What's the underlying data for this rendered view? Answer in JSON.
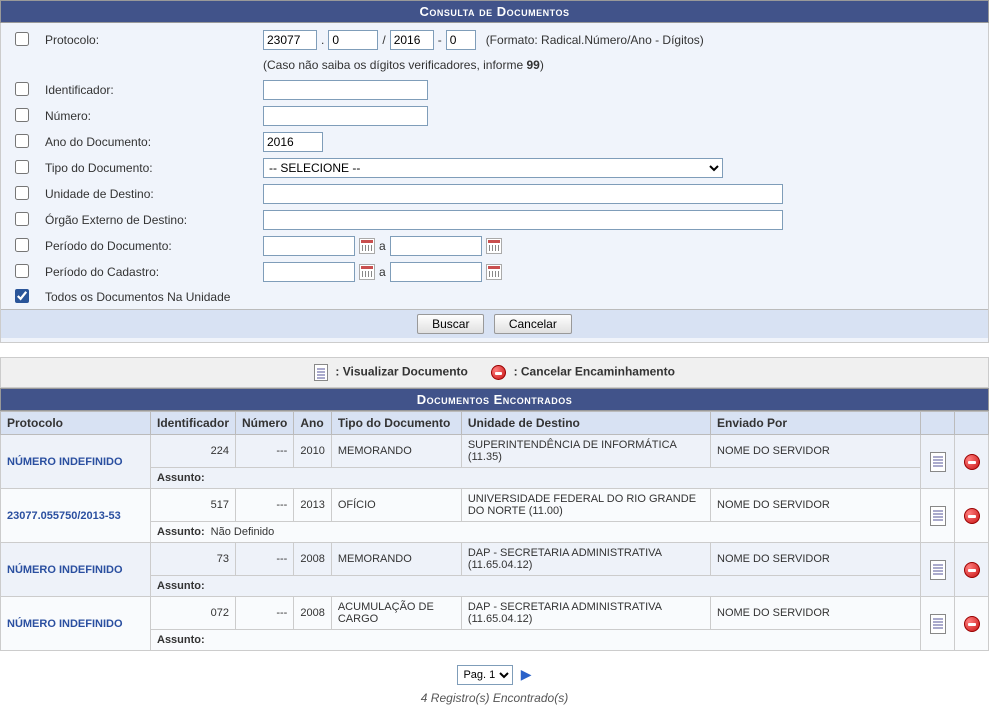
{
  "headers": {
    "form_title": "Consulta de Documentos",
    "results_title": "Documentos Encontrados"
  },
  "form": {
    "protocolo": {
      "label": "Protocolo:",
      "radical": "23077",
      "numero": "0",
      "ano": "2016",
      "digitos": "0",
      "format_hint": "(Formato: Radical.Número/Ano - Dígitos)",
      "hint2_a": "(Caso não saiba os dígitos verificadores, informe ",
      "hint2_b": "99",
      "hint2_c": ")"
    },
    "identificador_label": "Identificador:",
    "numero_label": "Número:",
    "ano_doc": {
      "label": "Ano do Documento:",
      "value": "2016"
    },
    "tipo_doc": {
      "label": "Tipo do Documento:",
      "selected": "-- SELECIONE --"
    },
    "unidade_destino_label": "Unidade de Destino:",
    "orgao_externo_label": "Órgão Externo de Destino:",
    "periodo_doc": {
      "label": "Período do Documento:",
      "sep": "a"
    },
    "periodo_cad": {
      "label": "Período do Cadastro:",
      "sep": "a"
    },
    "todos_label": "Todos os Documentos Na Unidade",
    "buttons": {
      "buscar": "Buscar",
      "cancelar": "Cancelar"
    }
  },
  "legend": {
    "view": ": Visualizar Documento",
    "cancel": ": Cancelar Encaminhamento"
  },
  "columns": {
    "protocolo": "Protocolo",
    "identificador": "Identificador",
    "numero": "Número",
    "ano": "Ano",
    "tipo": "Tipo do Documento",
    "unidade": "Unidade de Destino",
    "enviado": "Enviado Por"
  },
  "assunto_label": "Assunto:",
  "rows": [
    {
      "protocolo": "NÚMERO INDEFINIDO",
      "identificador": "224",
      "numero": "---",
      "ano": "2010",
      "tipo": "MEMORANDO",
      "unidade": "SUPERINTENDÊNCIA DE INFORMÁTICA (11.35)",
      "enviado": "NOME DO SERVIDOR",
      "assunto": ""
    },
    {
      "protocolo": "23077.055750/2013-53",
      "identificador": "517",
      "numero": "---",
      "ano": "2013",
      "tipo": "OFÍCIO",
      "unidade": "UNIVERSIDADE FEDERAL DO RIO GRANDE DO NORTE (11.00)",
      "enviado": "NOME DO SERVIDOR",
      "assunto": "Não Definido"
    },
    {
      "protocolo": "NÚMERO INDEFINIDO",
      "identificador": "73",
      "numero": "---",
      "ano": "2008",
      "tipo": "MEMORANDO",
      "unidade": "DAP - SECRETARIA ADMINISTRATIVA (11.65.04.12)",
      "enviado": "NOME DO SERVIDOR",
      "assunto": ""
    },
    {
      "protocolo": "NÚMERO INDEFINIDO",
      "identificador": "072",
      "numero": "---",
      "ano": "2008",
      "tipo": "ACUMULAÇÃO DE CARGO",
      "unidade": "DAP - SECRETARIA ADMINISTRATIVA (11.65.04.12)",
      "enviado": "NOME DO SERVIDOR",
      "assunto": ""
    }
  ],
  "pager": {
    "page_label": "Pag. 1"
  },
  "count_line": "4  Registro(s) Encontrado(s)"
}
